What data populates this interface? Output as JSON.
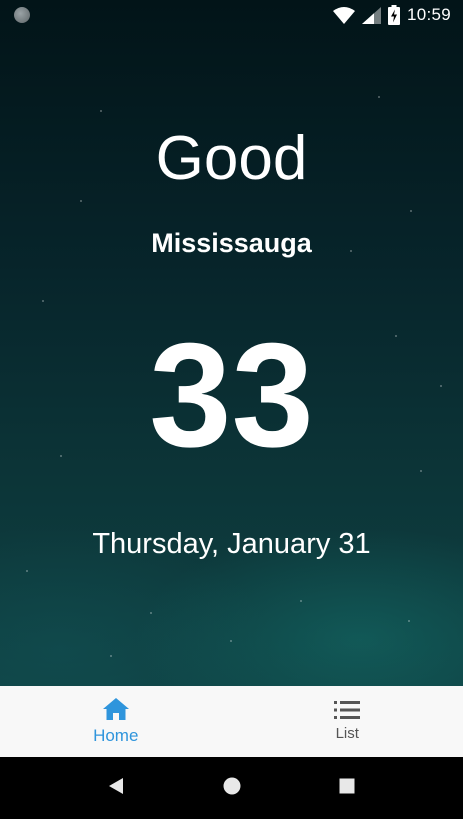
{
  "status_bar": {
    "time": "10:59"
  },
  "main": {
    "greeting": "Good",
    "city": "Mississauga",
    "temperature": "33",
    "date": "Thursday, January 31"
  },
  "bottom_nav": {
    "items": [
      {
        "label": "Home",
        "icon": "home-icon",
        "active": true,
        "color": "#2f95dc"
      },
      {
        "label": "List",
        "icon": "list-icon",
        "active": false,
        "color": "#555555"
      }
    ]
  },
  "system_nav": {
    "buttons": [
      "back-icon",
      "home-circle-icon",
      "recents-icon"
    ]
  }
}
